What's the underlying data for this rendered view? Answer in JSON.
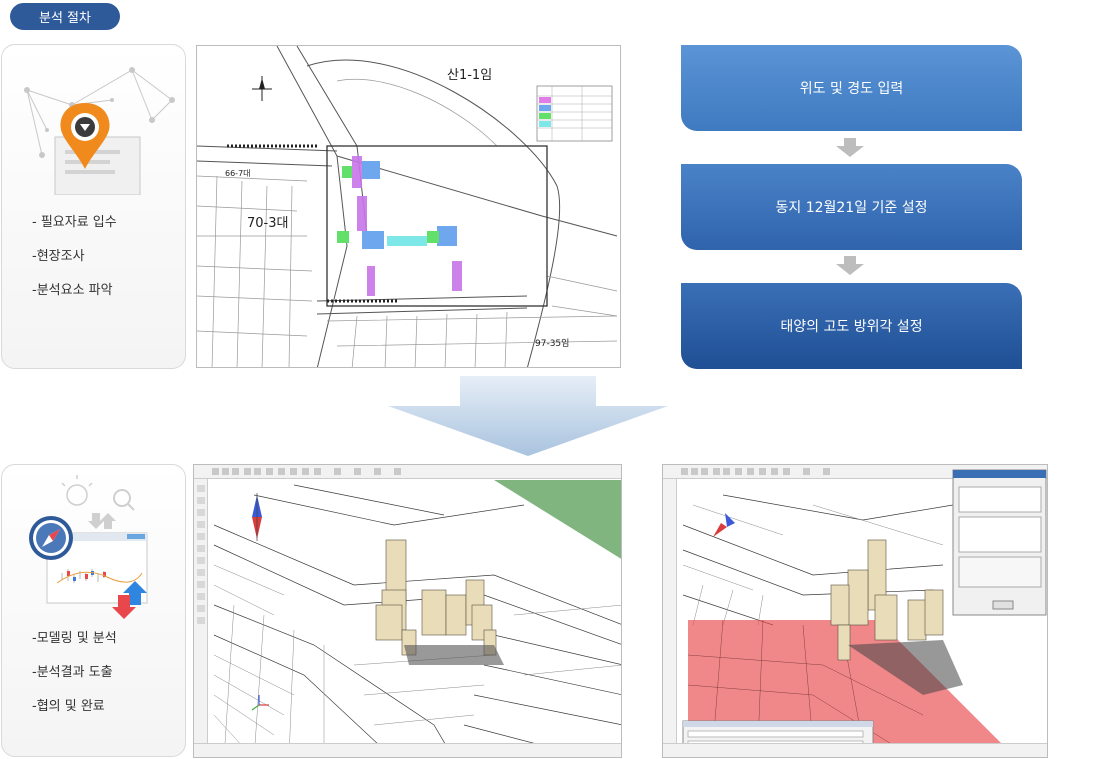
{
  "header": {
    "badge_label": "분석 절차"
  },
  "top_card": {
    "items": [
      "- 필요자료 입수",
      "-현장조사",
      "-분석요소 파악"
    ]
  },
  "bottom_card": {
    "items": [
      "-모델링 및 분석",
      "-분석결과 도출",
      "-협의 및 완료"
    ]
  },
  "map": {
    "label_san": "산1-1임",
    "label_70": "70-3대",
    "label_66": "66-7대",
    "label_97": "97-35임"
  },
  "steps": [
    {
      "label": "위도 및 경도 입력"
    },
    {
      "label": "동지 12월21일 기준 설정"
    },
    {
      "label": "태양의 고도 방위각 설정"
    }
  ],
  "colors": {
    "badge": "#2f5a9a",
    "step_top": "#5b95d6",
    "step_bottom": "#1f4f95",
    "big_arrow": "#b9cfe6",
    "shadow_red": "#e8484c",
    "pin_orange": "#f18a1d"
  },
  "icons": [
    "location-pin-icon",
    "compass-icon",
    "chart-icon",
    "lightbulb-icon",
    "magnifier-icon",
    "up-arrow-icon",
    "down-arrow-icon"
  ]
}
